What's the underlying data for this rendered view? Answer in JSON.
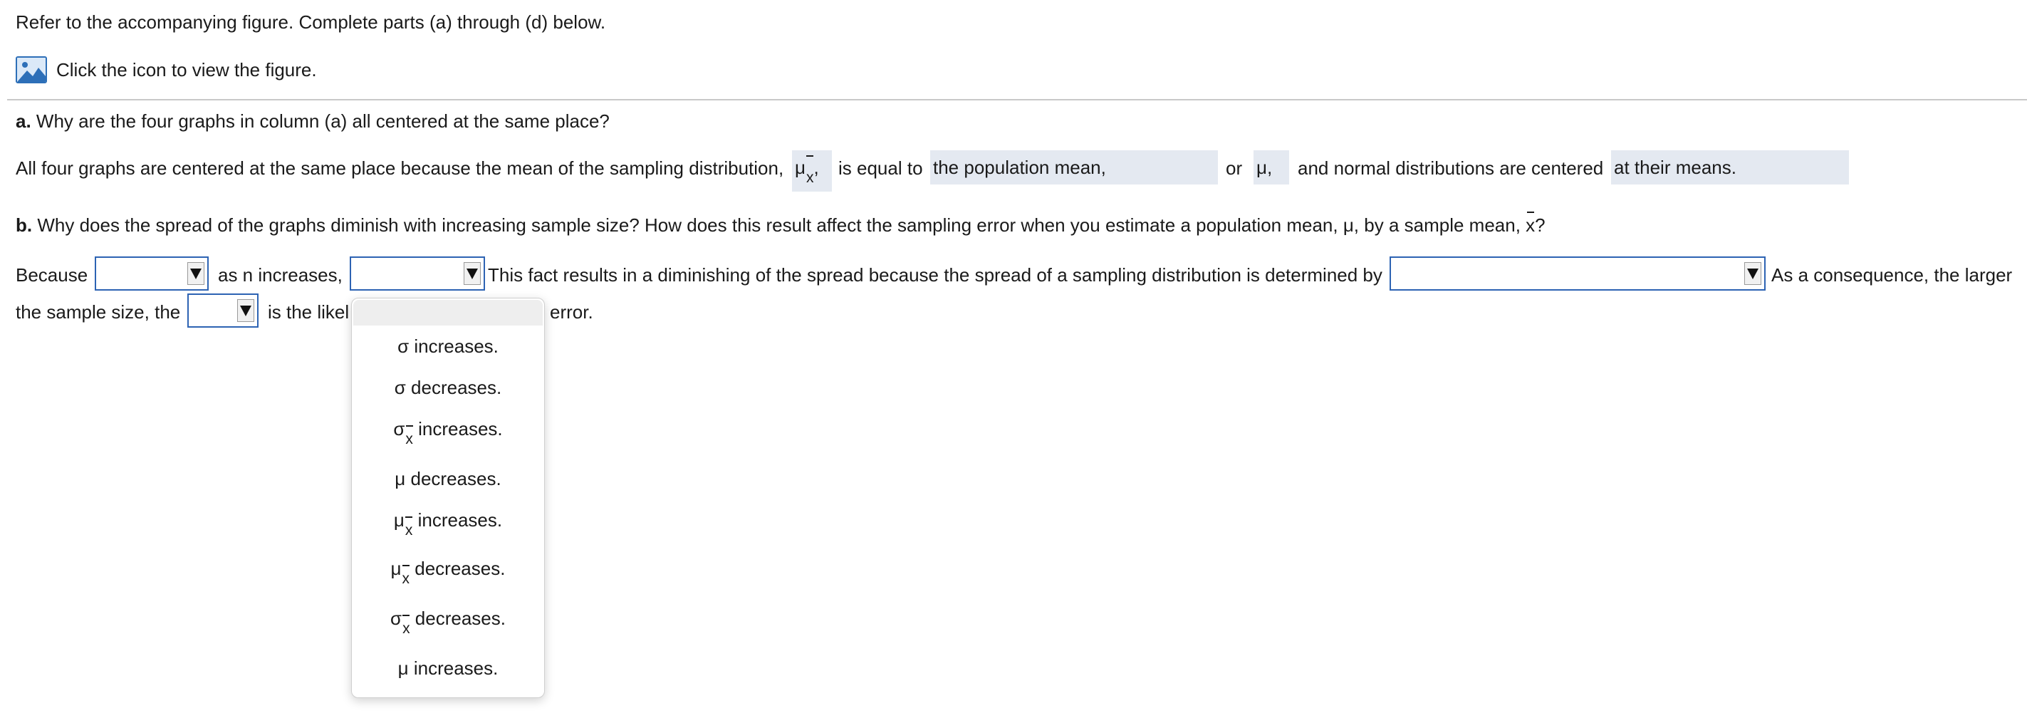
{
  "instructions": "Refer to the accompanying figure. Complete parts (a) through (d) below.",
  "figure_link": {
    "icon": "image-icon",
    "label": "Click the icon to view the figure."
  },
  "part_a": {
    "letter": "a.",
    "question": "Why are the four graphs in column (a) all centered at the same place?",
    "sentence": {
      "t1": "All four graphs are centered at the same place because the mean of the sampling distribution,",
      "sym1": "μ",
      "sym1_sub": "x",
      "sym1_comma": ",",
      "t2": "is equal to",
      "answer1": "the population mean,",
      "t3": "or",
      "answer2": "μ,",
      "t4": "and normal distributions are centered",
      "answer3": "at their means."
    }
  },
  "part_b": {
    "letter": "b.",
    "question": "Why does the spread of the graphs diminish with increasing sample size? How does this result affect the sampling error when you estimate a population mean, μ, by a sample mean,",
    "question_sym": "x",
    "question_end": "?",
    "sentence": {
      "t1": "Because",
      "t2": "as n increases,",
      "t3": "This fact results in a diminishing of the spread because the spread of a sampling distribution is determined by",
      "t4": "As a consequence, the larger",
      "t5": "the sample size, the",
      "t6": "is the likel",
      "t7": "error."
    },
    "dropdowns": {
      "d1": "",
      "d2": "",
      "d3": "",
      "d4": ""
    }
  },
  "dropdown_menu": {
    "options": [
      {
        "sym": "σ",
        "sub": "",
        "text": "increases."
      },
      {
        "sym": "σ",
        "sub": "",
        "text": "decreases."
      },
      {
        "sym": "σ",
        "sub": "x",
        "text": "increases."
      },
      {
        "sym": "μ",
        "sub": "",
        "text": "decreases."
      },
      {
        "sym": "μ",
        "sub": "x",
        "text": "increases."
      },
      {
        "sym": "μ",
        "sub": "x",
        "text": "decreases."
      },
      {
        "sym": "σ",
        "sub": "x",
        "text": "decreases."
      },
      {
        "sym": "μ",
        "sub": "",
        "text": "increases."
      }
    ]
  }
}
